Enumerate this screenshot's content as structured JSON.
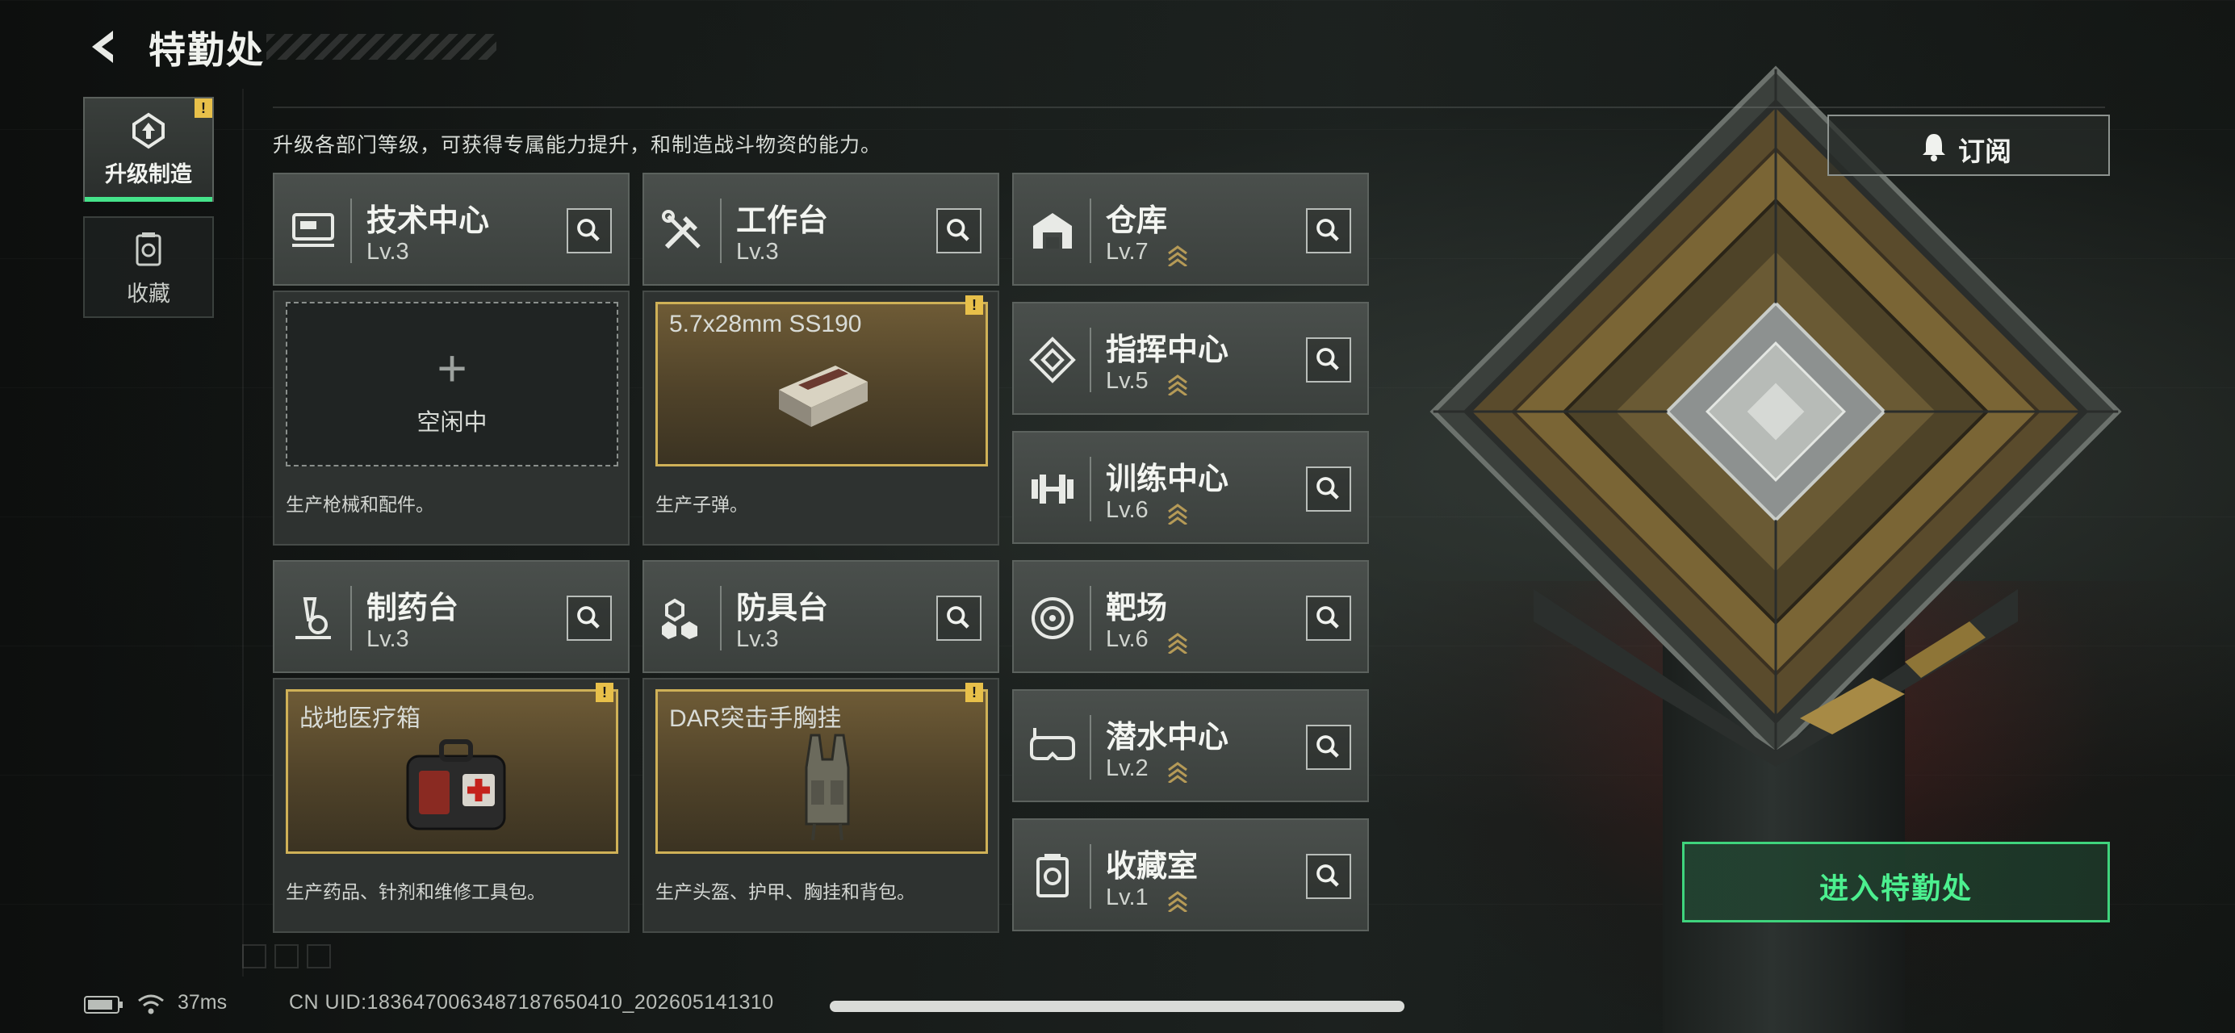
{
  "header": {
    "title": "特勤处"
  },
  "nav": [
    {
      "label": "升级制造",
      "active": true,
      "alert": "!"
    },
    {
      "label": "收藏",
      "active": false
    }
  ],
  "subtitle": "升级各部门等级，可获得专属能力提升，和制造战斗物资的能力。",
  "departments": {
    "tech": {
      "name": "技术中心",
      "level": "Lv.3"
    },
    "workbench": {
      "name": "工作台",
      "level": "Lv.3"
    },
    "pharmacy": {
      "name": "制药台",
      "level": "Lv.3"
    },
    "armor": {
      "name": "防具台",
      "level": "Lv.3"
    },
    "warehouse": {
      "name": "仓库",
      "level": "Lv.7"
    },
    "command": {
      "name": "指挥中心",
      "level": "Lv.5"
    },
    "training": {
      "name": "训练中心",
      "level": "Lv.6"
    },
    "range": {
      "name": "靶场",
      "level": "Lv.6"
    },
    "diving": {
      "name": "潜水中心",
      "level": "Lv.2"
    },
    "collection": {
      "name": "收藏室",
      "level": "Lv.1"
    }
  },
  "slots": {
    "tech": {
      "idle_text": "空闲中",
      "plus": "+",
      "desc": "生产枪械和配件。"
    },
    "workbench": {
      "item": "5.7x28mm SS190",
      "desc": "生产子弹。",
      "alert": "!"
    },
    "pharmacy": {
      "item": "战地医疗箱",
      "desc": "生产药品、针剂和维修工具包。",
      "alert": "!"
    },
    "armor": {
      "item": "DAR突击手胸挂",
      "desc": "生产头盔、护甲、胸挂和背包。",
      "alert": "!"
    }
  },
  "subscribe": {
    "label": "订阅"
  },
  "enter": {
    "label": "进入特勤处"
  },
  "status": {
    "ping": "37ms",
    "uid": "CN UID:1836470063487187650410_202605141310"
  },
  "colors": {
    "accent": "#45e38a",
    "alert": "#e8c04a",
    "card_border": "#cfb157"
  }
}
